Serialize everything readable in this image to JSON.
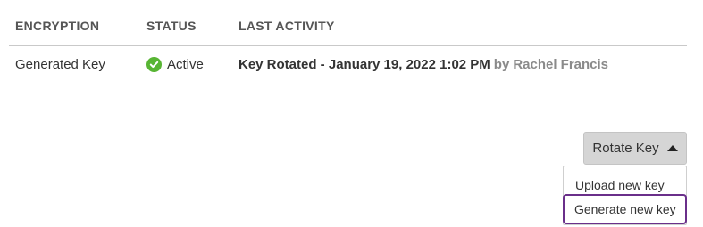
{
  "table": {
    "headers": {
      "encryption": "ENCRYPTION",
      "status": "STATUS",
      "last_activity": "LAST ACTIVITY"
    },
    "rows": [
      {
        "encryption": "Generated Key",
        "status": "Active",
        "activity_event": "Key Rotated - January 19, 2022 1:02 PM",
        "activity_by": "by",
        "activity_user": "Rachel Francis"
      }
    ]
  },
  "rotate_button": {
    "label": "Rotate Key"
  },
  "rotate_menu": {
    "items": [
      {
        "label": "Upload new key"
      },
      {
        "label": "Generate new key"
      }
    ]
  },
  "colors": {
    "status_active": "#58b534",
    "focus_outline": "#6a2f8a",
    "button_bg": "#d5d5d5"
  },
  "icons": {
    "status": "check-circle-icon",
    "button_caret": "caret-up-icon"
  }
}
